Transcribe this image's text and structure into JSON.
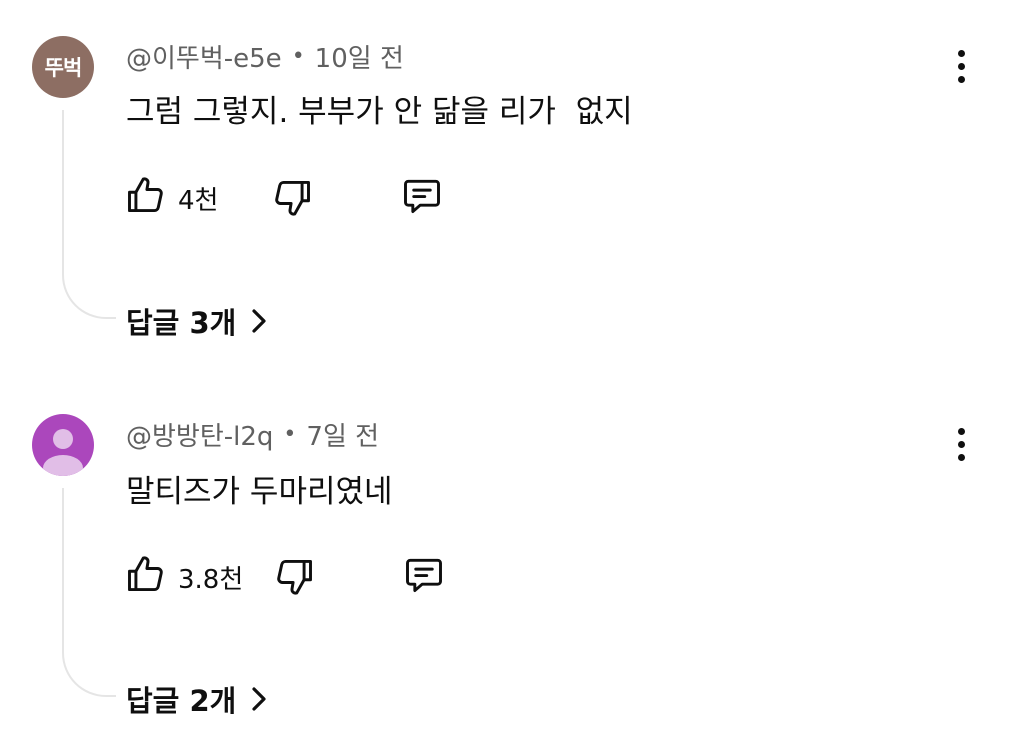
{
  "comments": [
    {
      "avatar_text": "뚜벅",
      "avatar_color": "#8d6e63",
      "handle": "@이뚜벅-e5e",
      "separator": "•",
      "time": "10일 전",
      "text": "그럼 그렇지. 부부가 안 닮을 리가  없지",
      "like_count": "4천",
      "replies_label": "답글 3개"
    },
    {
      "avatar_icon": "default-user-avatar",
      "avatar_color": "#ab47bc",
      "handle": "@방방탄-l2q",
      "separator": "•",
      "time": "7일 전",
      "text": "말티즈가 두마리였네",
      "like_count": "3.8천",
      "replies_label": "답글 2개"
    }
  ]
}
